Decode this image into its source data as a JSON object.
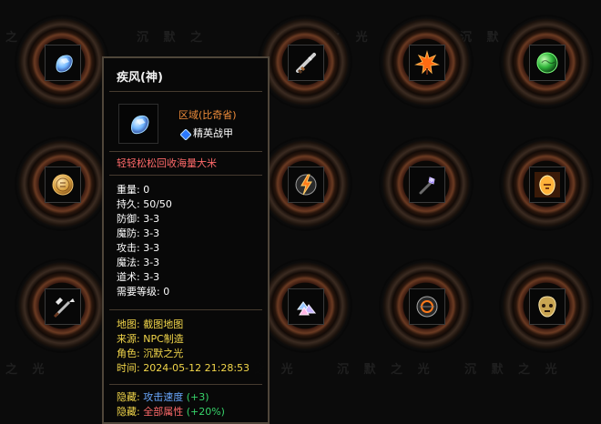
{
  "watermarks": [
    "之 光",
    "沉 默 之",
    "沉 默 之 光",
    "沉 默 之 光",
    "之 光",
    "沉 默 之 光",
    "沉 默 之 光",
    "沉 默 之 光"
  ],
  "slots": [
    {
      "name": "slot-1",
      "icon": "blue-gem-icon",
      "accent": "#7fc3ff"
    },
    {
      "name": "slot-2",
      "icon": "sword-icon",
      "accent": "#d6d6d6"
    },
    {
      "name": "slot-3",
      "icon": "maple-leaf-icon",
      "accent": "#ff7a1a"
    },
    {
      "name": "slot-4",
      "icon": "green-orb-icon",
      "accent": "#2fb53a"
    },
    {
      "name": "slot-5",
      "icon": "gold-medal-icon",
      "accent": "#d8a24a"
    },
    {
      "name": "slot-6",
      "icon": "lightning-icon",
      "accent": "#ff8a2a"
    },
    {
      "name": "slot-7",
      "icon": "purple-scepter-icon",
      "accent": "#9b7cff"
    },
    {
      "name": "slot-8",
      "icon": "golden-warrior-icon",
      "accent": "#ffb23a"
    },
    {
      "name": "slot-9",
      "icon": "axes-icon",
      "accent": "#e6e6e6"
    },
    {
      "name": "slot-10",
      "icon": "crystal-pile-icon",
      "accent": "#b1c7ff"
    },
    {
      "name": "slot-11",
      "icon": "rune-orb-icon",
      "accent": "#ff7a1a"
    },
    {
      "name": "slot-12",
      "icon": "golden-skull-icon",
      "accent": "#c9a552"
    }
  ],
  "tooltip": {
    "title": "疾风(神)",
    "region": "区域(比奇省)",
    "type": "精英战甲",
    "flavor": "轻轻松松回收海量大米",
    "stats": [
      {
        "label": "重量:",
        "value": "0"
      },
      {
        "label": "持久:",
        "value": "50/50"
      },
      {
        "label": "防御:",
        "value": "3-3"
      },
      {
        "label": "魔防:",
        "value": "3-3"
      },
      {
        "label": "攻击:",
        "value": "3-3"
      },
      {
        "label": "魔法:",
        "value": "3-3"
      },
      {
        "label": "道术:",
        "value": "3-3"
      },
      {
        "label": "需要等级:",
        "value": "0"
      }
    ],
    "meta": [
      {
        "label": "地图:",
        "value": "截图地图"
      },
      {
        "label": "来源:",
        "value": "NPC制造"
      },
      {
        "label": "角色:",
        "value": "沉默之光"
      },
      {
        "label": "时间:",
        "value": "2024-05-12 21:28:53"
      }
    ],
    "hidden": [
      {
        "label": "隐藏:",
        "value": "攻击速度",
        "bonus": "(+3)"
      },
      {
        "label": "隐藏:",
        "value": "全部属性",
        "bonus": "(+20%)"
      }
    ]
  },
  "colors": {
    "frame_border": "#4f463a",
    "region_text": "#f08d3a",
    "yellow_text": "#f2d64a",
    "blue_text": "#6aa8ff",
    "red_text": "#ff6a6a",
    "green_text": "#37d36a"
  }
}
